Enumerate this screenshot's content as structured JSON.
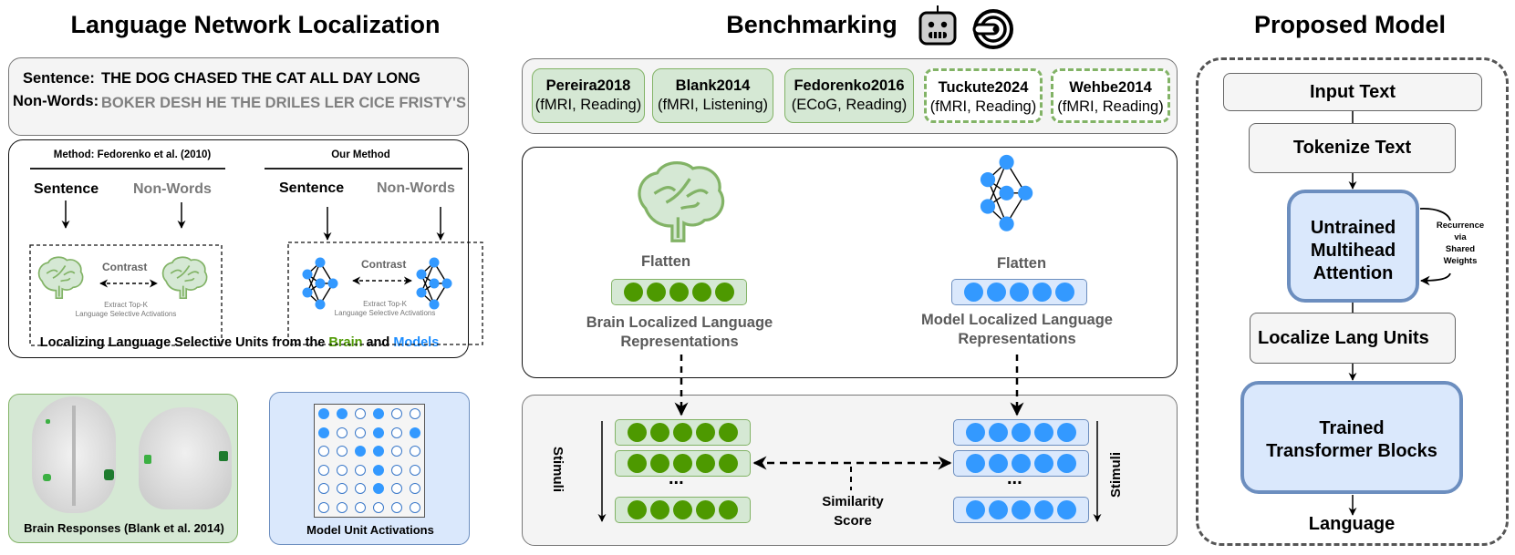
{
  "sections": {
    "left_title": "Language Network Localization",
    "middle_title": "Benchmarking",
    "right_title": "Proposed Model"
  },
  "stimuli_box": {
    "sentence_label": "Sentence:",
    "sentence_text": "THE DOG CHASED THE CAT ALL DAY LONG",
    "nonwords_label": "Non-Words:",
    "nonwords_text": "BOKER DESH HE THE DRILES LER CICE FRISTY'S"
  },
  "methods_box": {
    "left_method_title": "Method: Fedorenko et al. (2010)",
    "right_method_title": "Our Method",
    "sentence": "Sentence",
    "nonwords": "Non-Words",
    "contrast": "Contrast",
    "extract_line1": "Extract Top-K",
    "extract_line2": "Language Selective Activations",
    "caption_prefix": "Localizing Language Selective Units from the ",
    "caption_brain": "Brain",
    "caption_and": " and ",
    "caption_models": "Models",
    "brain_color": "#4d9900",
    "models_color": "#1a8cff"
  },
  "brain_responses": {
    "caption": "Brain Responses (Blank et al. 2014)"
  },
  "model_units": {
    "caption": "Model Unit Activations",
    "grid": [
      [
        1,
        1,
        0,
        1,
        0,
        0
      ],
      [
        1,
        0,
        0,
        1,
        0,
        1
      ],
      [
        0,
        0,
        1,
        1,
        0,
        0
      ],
      [
        0,
        0,
        0,
        1,
        0,
        0
      ],
      [
        0,
        0,
        0,
        1,
        0,
        0
      ],
      [
        0,
        0,
        0,
        0,
        0,
        0
      ]
    ]
  },
  "benchmark_icons": [
    "robot-icon",
    "mri-scanner-icon"
  ],
  "datasets": [
    {
      "name": "Pereira2018",
      "detail": "(fMRI, Reading)",
      "style": "solid"
    },
    {
      "name": "Blank2014",
      "detail": "(fMRI, Listening)",
      "style": "solid"
    },
    {
      "name": "Fedorenko2016",
      "detail": "(ECoG, Reading)",
      "style": "solid"
    },
    {
      "name": "Tuckute2024",
      "detail": "(fMRI, Reading)",
      "style": "dashed"
    },
    {
      "name": "Wehbe2014",
      "detail": "(fMRI, Reading)",
      "style": "dashed"
    }
  ],
  "flatten": {
    "brain_label": "Flatten",
    "brain_repr_line1": "Brain Localized Language",
    "brain_repr_line2": "Representations",
    "model_label": "Flatten",
    "model_repr_line1": "Model Localized Language",
    "model_repr_line2": "Representations"
  },
  "similarity": {
    "stimuli_left": "Stimuli",
    "stimuli_right": "Stimuli",
    "ellipsis": "...",
    "score_line1": "Similarity",
    "score_line2": "Score"
  },
  "proposed_model": {
    "input_text": "Input Text",
    "tokenize": "Tokenize Text",
    "attention_line1": "Untrained",
    "attention_line2": "Multihead",
    "attention_line3": "Attention",
    "recurrence_line1": "Recurrence",
    "recurrence_line2": "via",
    "recurrence_line3": "Shared",
    "recurrence_line4": "Weights",
    "localize": "Localize Lang Units",
    "trained_line1": "Trained",
    "trained_line2": "Transformer Blocks",
    "output": "Language"
  }
}
